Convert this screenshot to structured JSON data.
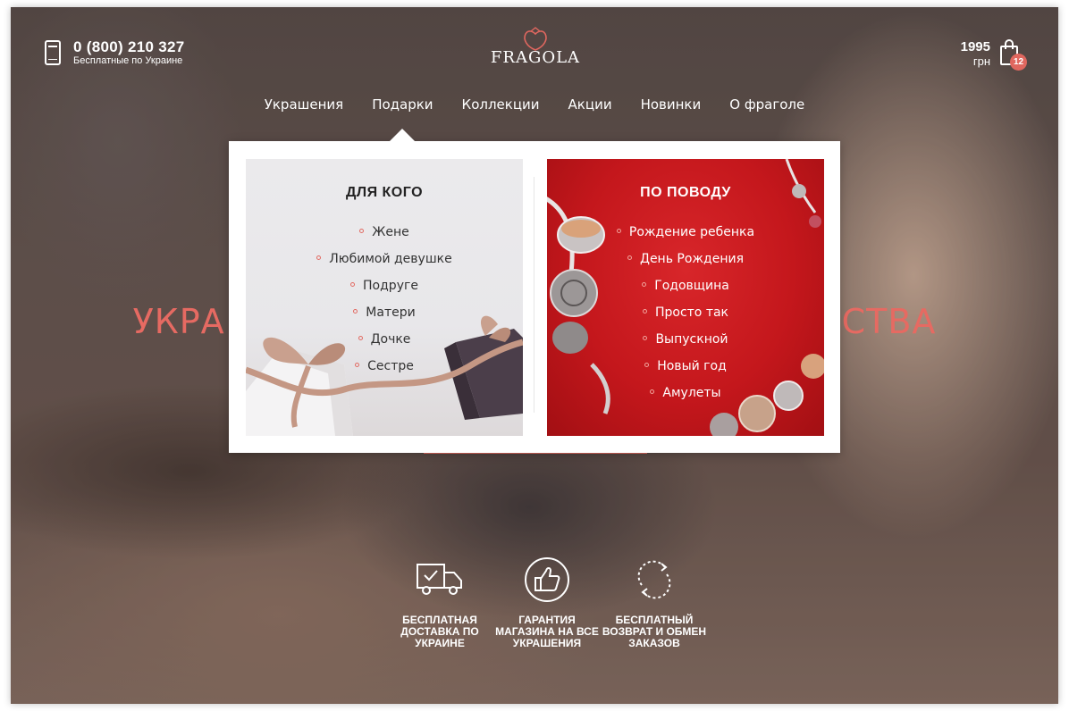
{
  "header": {
    "phone": "0 (800) 210 327",
    "phone_note": "Бесплатные по Украине",
    "logo": "FRAGOLA",
    "cart_amount": "1995",
    "cart_currency": "грн",
    "cart_count": "12"
  },
  "nav": {
    "items": [
      {
        "label": "Украшения"
      },
      {
        "label": "Подарки"
      },
      {
        "label": "Коллекции"
      },
      {
        "label": "Акции"
      },
      {
        "label": "Новинки"
      },
      {
        "label": "О фраголе"
      }
    ]
  },
  "hero": {
    "title_left": "УКРА",
    "title_right": "СТВА"
  },
  "dropdown": {
    "for_whom": {
      "title": "ДЛЯ КОГО",
      "items": [
        "Жене",
        "Любимой девушке",
        "Подруге",
        "Матери",
        "Дочке",
        "Сестре"
      ]
    },
    "occasion": {
      "title": "ПО ПОВОДУ",
      "items": [
        "Рождение ребенка",
        "День Рождения",
        "Годовщина",
        "Просто так",
        "Выпускной",
        "Новый год",
        "Амулеты"
      ]
    }
  },
  "features": [
    {
      "icon": "truck-check-icon",
      "text": "Бесплатная доставка по Украине"
    },
    {
      "icon": "thumbs-up-icon",
      "text": "Гарантия магазина на все украшения"
    },
    {
      "icon": "refresh-icon",
      "text": "Бесплатный возврат и обмен заказов"
    }
  ],
  "colors": {
    "accent": "#e0675f",
    "occasion_bg": "#c4171c"
  }
}
